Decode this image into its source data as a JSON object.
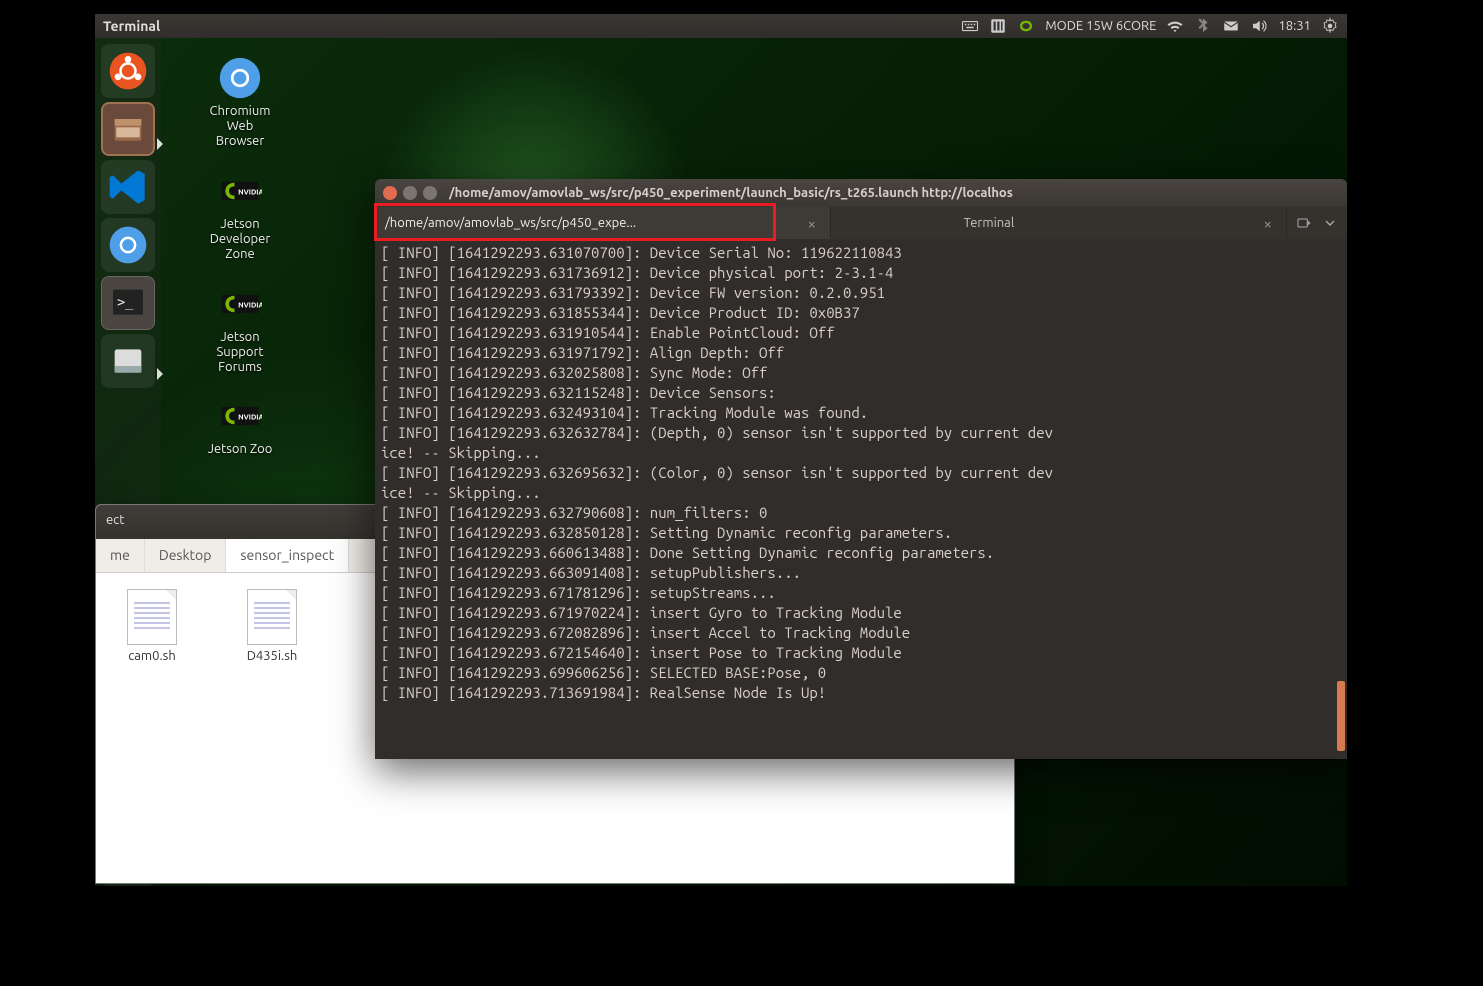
{
  "topbar": {
    "app_title": "Terminal",
    "mode_text": "MODE 15W 6CORE",
    "clock": "18:31"
  },
  "launcher": {
    "items": [
      {
        "name": "ubuntu-dash"
      },
      {
        "name": "files"
      },
      {
        "name": "vscode"
      },
      {
        "name": "chromium"
      },
      {
        "name": "terminal"
      },
      {
        "name": "disk"
      }
    ]
  },
  "desktop": {
    "icons": [
      {
        "name": "chromium",
        "label": "Chromium\nWeb\nBrowser"
      },
      {
        "name": "jetson-dev",
        "label": "Jetson\nDeveloper\nZone"
      },
      {
        "name": "jetson-support",
        "label": "Jetson\nSupport\nForums"
      },
      {
        "name": "jetson-zoo",
        "label": "Jetson Zoo"
      }
    ]
  },
  "files": {
    "header": "ect",
    "tabs": [
      "me",
      "Desktop",
      "sensor_inspect"
    ],
    "items": [
      "cam0.sh",
      "D435i.sh"
    ]
  },
  "terminal": {
    "window_title": "/home/amov/amovlab_ws/src/p450_experiment/launch_basic/rs_t265.launch http://localhos",
    "tabs": [
      {
        "label": "/home/amov/amovlab_ws/src/p450_expe...",
        "active": true
      },
      {
        "label": "Terminal",
        "active": false
      }
    ],
    "log_lines": [
      "[ INFO] [1641292293.631070700]: Device Serial No: 119622110843",
      "[ INFO] [1641292293.631736912]: Device physical port: 2-3.1-4",
      "[ INFO] [1641292293.631793392]: Device FW version: 0.2.0.951",
      "[ INFO] [1641292293.631855344]: Device Product ID: 0x0B37",
      "[ INFO] [1641292293.631910544]: Enable PointCloud: Off",
      "[ INFO] [1641292293.631971792]: Align Depth: Off",
      "[ INFO] [1641292293.632025808]: Sync Mode: Off",
      "[ INFO] [1641292293.632115248]: Device Sensors: ",
      "[ INFO] [1641292293.632493104]: Tracking Module was found.",
      "[ INFO] [1641292293.632632784]: (Depth, 0) sensor isn't supported by current dev",
      "ice! -- Skipping...",
      "[ INFO] [1641292293.632695632]: (Color, 0) sensor isn't supported by current dev",
      "ice! -- Skipping...",
      "[ INFO] [1641292293.632790608]: num_filters: 0",
      "[ INFO] [1641292293.632850128]: Setting Dynamic reconfig parameters.",
      "[ INFO] [1641292293.660613488]: Done Setting Dynamic reconfig parameters.",
      "[ INFO] [1641292293.663091408]: setupPublishers...",
      "[ INFO] [1641292293.671781296]: setupStreams...",
      "[ INFO] [1641292293.671970224]: insert Gyro to Tracking Module",
      "[ INFO] [1641292293.672082896]: insert Accel to Tracking Module",
      "[ INFO] [1641292293.672154640]: insert Pose to Tracking Module",
      "[ INFO] [1641292293.699606256]: SELECTED BASE:Pose, 0",
      "[ INFO] [1641292293.713691984]: RealSense Node Is Up!"
    ]
  }
}
